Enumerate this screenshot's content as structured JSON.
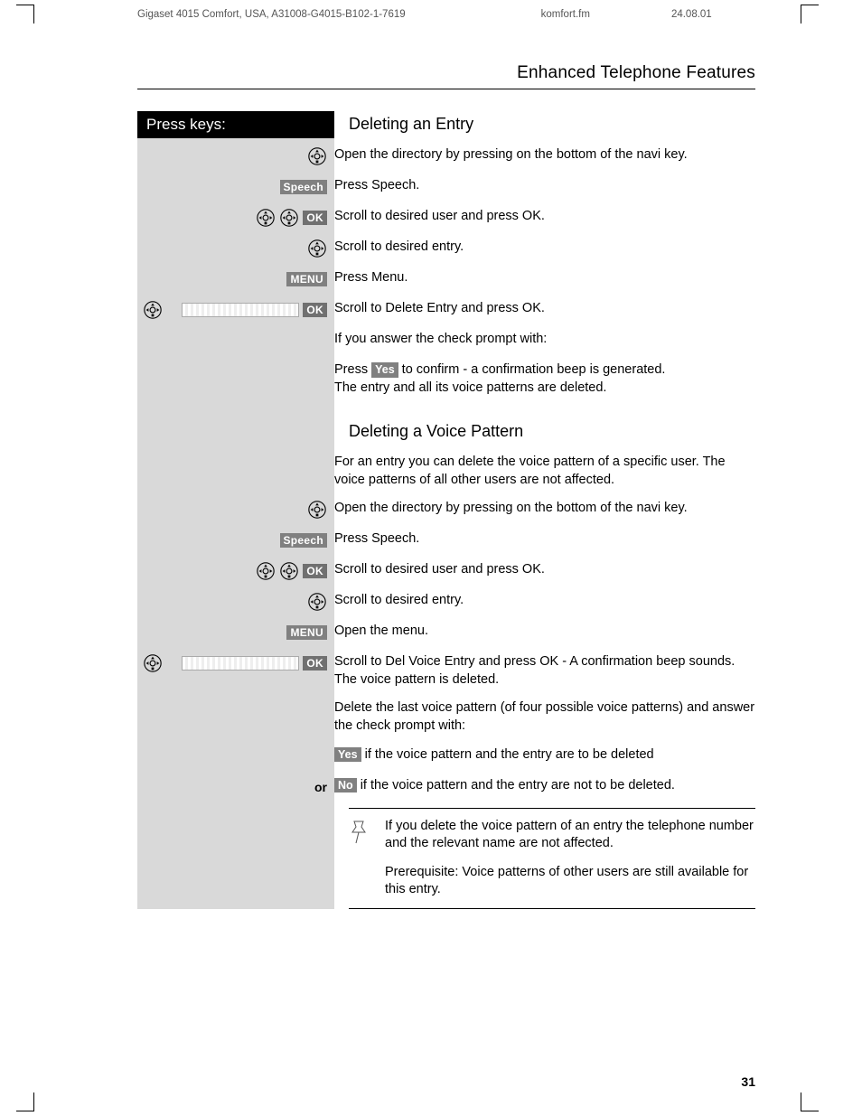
{
  "meta": {
    "doc_id": "Gigaset 4015 Comfort, USA, A31008-G4015-B102-1-7619",
    "file": "komfort.fm",
    "date": "24.08.01"
  },
  "section_title": "Enhanced Telephone Features",
  "press_keys_label": "Press keys:",
  "labels": {
    "speech": "Speech",
    "ok": "OK",
    "menu": "MENU",
    "yes": "Yes",
    "no": "No",
    "or": "or"
  },
  "s1": {
    "heading": "Deleting an Entry",
    "r1": "Open the directory by pressing on the bottom of the navi key.",
    "r2": "Press Speech.",
    "r3": "Scroll to desired user and press OK.",
    "r4": "Scroll to desired entry.",
    "r5": "Press Menu.",
    "r6": "Scroll to Delete Entry and press OK.",
    "r7": "If you answer the check prompt with:",
    "r8a": "Press ",
    "r8b": " to confirm - a confirmation beep is generated.",
    "r8c": "The entry and all its voice patterns are deleted."
  },
  "s2": {
    "heading": "Deleting a Voice Pattern",
    "intro": "For an entry you can delete the voice pattern of a specific user. The voice patterns of all other users are not affected.",
    "r1": "Open the directory by pressing on the bottom of the navi key.",
    "r2": "Press Speech.",
    "r3": "Scroll to desired user and press OK.",
    "r4": "Scroll to desired entry.",
    "r5": "Open the menu.",
    "r6": "Scroll to Del Voice Entry and press OK - A confirmation beep sounds. The voice pattern is deleted.",
    "r7": "Delete the last voice pattern (of four possible voice patterns) and answer the check prompt with:",
    "r8": " if the voice pattern and the entry are to be deleted",
    "r9": " if the voice pattern and the entry are not to be deleted."
  },
  "note": {
    "p1": "If you delete the voice pattern of an entry the telephone number and the relevant name are not affected.",
    "p2": "Prerequisite: Voice patterns of other users are still available for this entry."
  },
  "page_number": "31"
}
